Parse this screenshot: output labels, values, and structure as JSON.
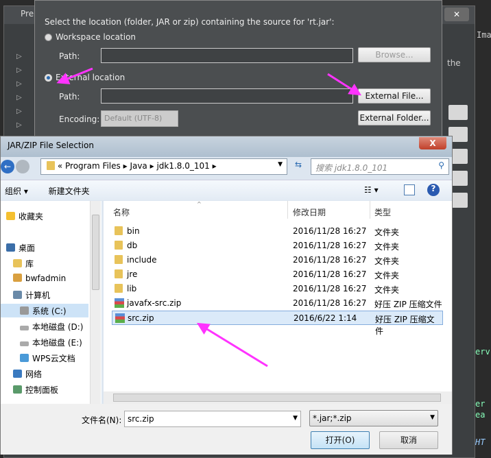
{
  "background": {
    "pref_title": "Pre",
    "right_texts": [
      "Ima",
      "the",
      "erv",
      "er",
      "ea",
      "HT"
    ]
  },
  "source_dialog": {
    "prompt": "Select the location (folder, JAR or zip) containing the source for 'rt.jar':",
    "workspace_label": "Workspace location",
    "path_label": "Path:",
    "browse": "Browse...",
    "external_label": "External location",
    "path_label2": "Path:",
    "external_file": "External File...",
    "encoding_label": "Encoding:",
    "encoding_value": "Default (UTF-8)",
    "external_folder": "External Folder...",
    "selected_radio": "external"
  },
  "file_dialog": {
    "title": "JAR/ZIP File Selection",
    "close": "X",
    "breadcrumb": [
      "«",
      "Program Files",
      "Java",
      "jdk1.8.0_101"
    ],
    "search_placeholder": "搜索 jdk1.8.0_101",
    "toolbar": {
      "organize": "组织 ▾",
      "new_folder": "新建文件夹"
    },
    "nav": [
      {
        "label": "收藏夹",
        "icon": "star-icon"
      },
      {
        "label": "桌面",
        "icon": "desktop-icon"
      },
      {
        "label": "库",
        "icon": "library-icon"
      },
      {
        "label": "bwfadmin",
        "icon": "user-folder-icon"
      },
      {
        "label": "计算机",
        "icon": "computer-icon"
      },
      {
        "label": "系统 (C:)",
        "icon": "drive-icon",
        "selected": true
      },
      {
        "label": "本地磁盘 (D:)",
        "icon": "drive-icon"
      },
      {
        "label": "本地磁盘 (E:)",
        "icon": "drive-icon"
      },
      {
        "label": "WPS云文档",
        "icon": "cloud-icon"
      },
      {
        "label": "网络",
        "icon": "network-icon"
      },
      {
        "label": "控制面板",
        "icon": "control-panel-icon"
      }
    ],
    "columns": [
      "名称",
      "修改日期",
      "类型"
    ],
    "files": [
      {
        "name": "bin",
        "date": "2016/11/28 16:27",
        "type": "文件夹",
        "kind": "folder"
      },
      {
        "name": "db",
        "date": "2016/11/28 16:27",
        "type": "文件夹",
        "kind": "folder"
      },
      {
        "name": "include",
        "date": "2016/11/28 16:27",
        "type": "文件夹",
        "kind": "folder"
      },
      {
        "name": "jre",
        "date": "2016/11/28 16:27",
        "type": "文件夹",
        "kind": "folder"
      },
      {
        "name": "lib",
        "date": "2016/11/28 16:27",
        "type": "文件夹",
        "kind": "folder"
      },
      {
        "name": "javafx-src.zip",
        "date": "2016/11/28 16:27",
        "type": "好压 ZIP 压缩文件",
        "kind": "zip"
      },
      {
        "name": "src.zip",
        "date": "2016/6/22 1:14",
        "type": "好压 ZIP 压缩文件",
        "kind": "zip",
        "selected": true
      }
    ],
    "filename_label": "文件名(N):",
    "filename_value": "src.zip",
    "filter_value": "*.jar;*.zip",
    "open": "打开(O)",
    "cancel": "取消"
  },
  "annotation_color": "#ff33ff"
}
